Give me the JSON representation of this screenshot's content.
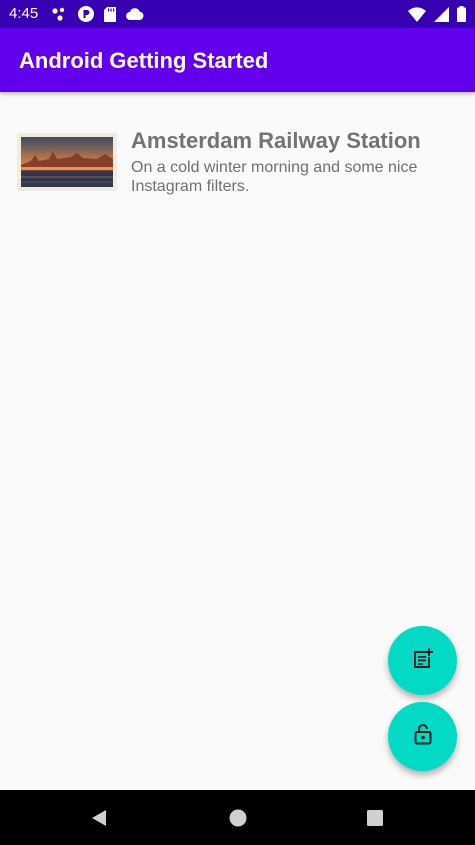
{
  "status_bar": {
    "time": "4:45",
    "left_icons": [
      "dots-icon",
      "p-badge-icon",
      "sd-card-icon",
      "cloud-icon"
    ],
    "right_icons": [
      "wifi-icon",
      "signal-icon",
      "battery-icon"
    ]
  },
  "app_bar": {
    "title": "Android Getting Started",
    "color": "#6200ee",
    "status_color": "#3700b3"
  },
  "list": {
    "items": [
      {
        "title": "Amsterdam Railway Station",
        "description": "On a cold winter morning and some nice Instagram filters.",
        "thumbnail": "railway-station-photo"
      }
    ]
  },
  "fabs": [
    {
      "icon": "note-add-icon",
      "color": "#03dac5"
    },
    {
      "icon": "lock-open-icon",
      "color": "#03dac5"
    }
  ],
  "nav_bar": {
    "buttons": [
      "back-icon",
      "home-icon",
      "recent-apps-icon"
    ]
  }
}
